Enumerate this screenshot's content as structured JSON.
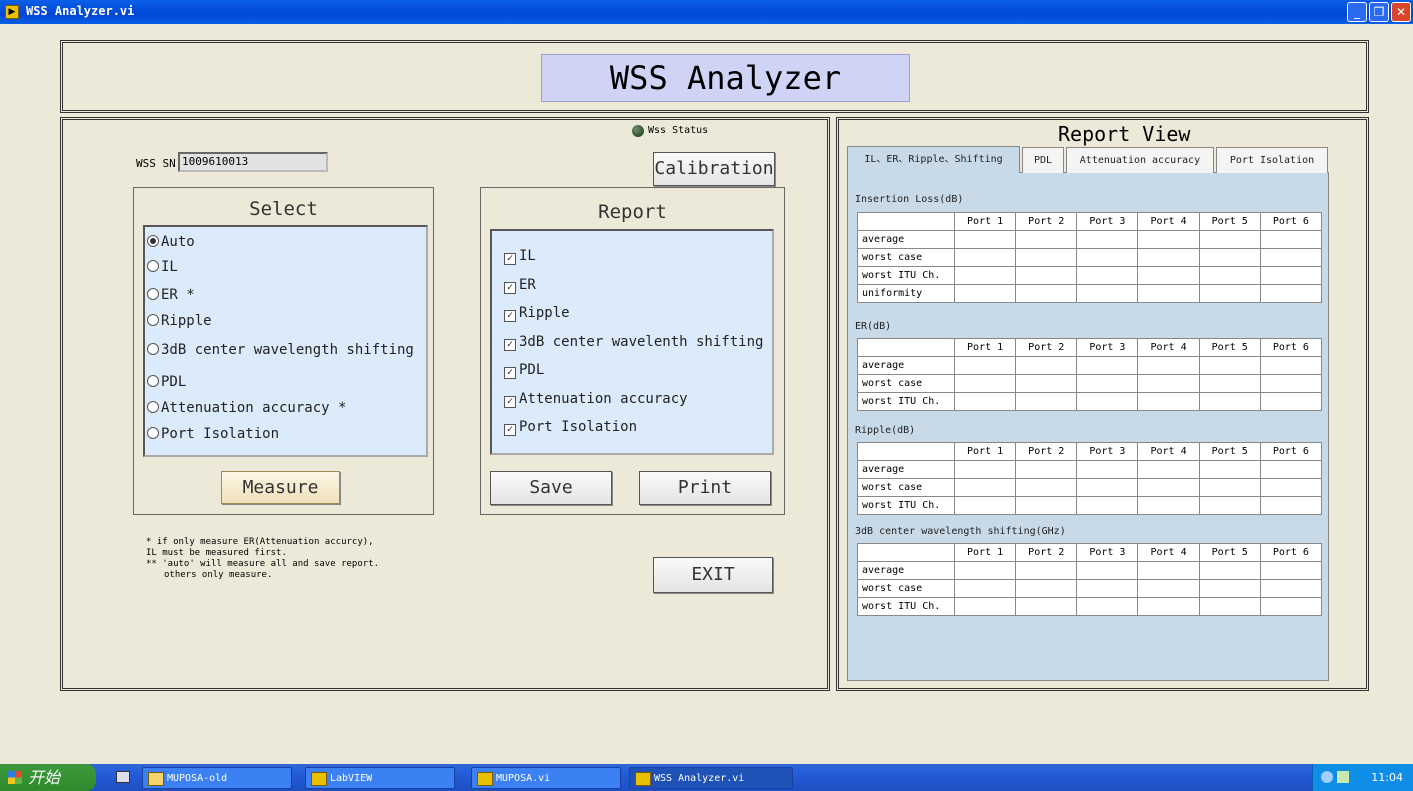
{
  "window": {
    "title": "WSS Analyzer.vi",
    "app_icon": "labview-icon"
  },
  "header": {
    "title": "WSS Analyzer"
  },
  "left": {
    "status_label": "Wss Status",
    "sn_label": "WSS SN:",
    "sn_value": "1009610013",
    "calibration_label": "Calibration",
    "select": {
      "title": "Select",
      "options": [
        "Auto",
        "IL",
        "ER *",
        "Ripple",
        "3dB center wavelength shifting",
        "PDL",
        "Attenuation accuracy *",
        "Port Isolation"
      ],
      "selected": "Auto"
    },
    "measure_label": "Measure",
    "report": {
      "title": "Report",
      "options": [
        "IL",
        "ER",
        "Ripple",
        "3dB center wavelenth shifting",
        "PDL",
        "Attenuation accuracy",
        "Port Isolation"
      ]
    },
    "save_label": "Save",
    "print_label": "Print",
    "notes": [
      "* if only measure ER(Attenuation accurcy),",
      "IL must be measured first.",
      "** 'auto' will measure all and save report.",
      "others only measure."
    ],
    "exit_label": "EXIT"
  },
  "report_view": {
    "title": "Report View",
    "tabs": [
      "IL、ER、Ripple、Shifting",
      "PDL",
      "Attenuation accuracy",
      "Port Isolation"
    ],
    "active_tab": "IL、ER、Ripple、Shifting",
    "columns": [
      "",
      "Port 1",
      "Port 2",
      "Port 3",
      "Port 4",
      "Port 5",
      "Port 6"
    ],
    "sections": [
      {
        "label": "Insertion Loss(dB)",
        "rows": [
          "average",
          "worst case",
          "worst ITU Ch.",
          "uniformity"
        ]
      },
      {
        "label": "ER(dB)",
        "rows": [
          "average",
          "worst case",
          "worst ITU Ch."
        ]
      },
      {
        "label": "Ripple(dB)",
        "rows": [
          "average",
          "worst case",
          "worst ITU Ch."
        ]
      },
      {
        "label": "3dB center wavelength shifting(GHz)",
        "rows": [
          "average",
          "worst case",
          "worst ITU Ch."
        ]
      }
    ]
  },
  "taskbar": {
    "start_label": "开始",
    "items": [
      "MUPOSA-old",
      "LabVIEW",
      "MUPOSA.vi",
      "WSS Analyzer.vi"
    ],
    "active_item": "WSS Analyzer.vi",
    "clock": "11:04"
  },
  "colors": {
    "title_bar": "#0a5fe8",
    "panel_blue": "#dcebfb",
    "tab_body": "#c8dae8",
    "header_box": "#cfd3f6"
  }
}
